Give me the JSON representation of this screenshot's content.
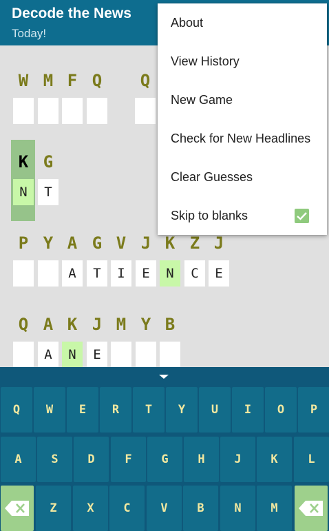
{
  "app": {
    "title": "Decode the News",
    "subtitle": "Today!"
  },
  "puzzle": {
    "words": [
      {
        "cells": [
          {
            "c": "W",
            "g": ""
          },
          {
            "c": "M",
            "g": ""
          },
          {
            "c": "F",
            "g": ""
          },
          {
            "c": "Q",
            "g": ""
          }
        ]
      },
      {
        "cells": [
          {
            "c": "Q",
            "g": ""
          }
        ]
      },
      {
        "cells": [
          {
            "c": "K",
            "g": "N",
            "hl": true,
            "active": true
          },
          {
            "c": "G",
            "g": "T"
          }
        ]
      },
      {
        "cells": [
          {
            "c": "P",
            "g": ""
          },
          {
            "c": "Y",
            "g": ""
          },
          {
            "c": "A",
            "g": "A"
          },
          {
            "c": "G",
            "g": "T"
          },
          {
            "c": "V",
            "g": "I"
          },
          {
            "c": "J",
            "g": "E"
          },
          {
            "c": "K",
            "g": "N",
            "hl": true
          },
          {
            "c": "Z",
            "g": "C"
          },
          {
            "c": "J",
            "g": "E"
          }
        ]
      },
      {
        "cells": [
          {
            "c": "Q",
            "g": ""
          },
          {
            "c": "A",
            "g": "A"
          },
          {
            "c": "K",
            "g": "N",
            "hl": true
          },
          {
            "c": "J",
            "g": "E"
          },
          {
            "c": "M",
            "g": ""
          },
          {
            "c": "Y",
            "g": ""
          },
          {
            "c": "B",
            "g": ""
          }
        ]
      }
    ]
  },
  "menu": {
    "items": [
      {
        "label": "About"
      },
      {
        "label": "View History"
      },
      {
        "label": "New Game"
      },
      {
        "label": "Check for New Headlines"
      },
      {
        "label": "Clear Guesses"
      },
      {
        "label": "Skip to blanks",
        "checked": true
      }
    ]
  },
  "keyboard": {
    "rows": [
      [
        "Q",
        "W",
        "E",
        "R",
        "T",
        "Y",
        "U",
        "I",
        "O",
        "P"
      ],
      [
        "A",
        "S",
        "D",
        "F",
        "G",
        "H",
        "J",
        "K",
        "L"
      ],
      [
        "Z",
        "X",
        "C",
        "V",
        "B",
        "N",
        "M"
      ]
    ],
    "backspace_icon": "backspace-icon"
  },
  "colors": {
    "appbar": "#0e6d8f",
    "cipher_text": "#7b7b1c",
    "highlight": "#c8f7a8",
    "selected_column": "#96c38a",
    "key_bg": "#126c8a",
    "key_text": "#f1e8a0",
    "check": "#8fca7d"
  }
}
